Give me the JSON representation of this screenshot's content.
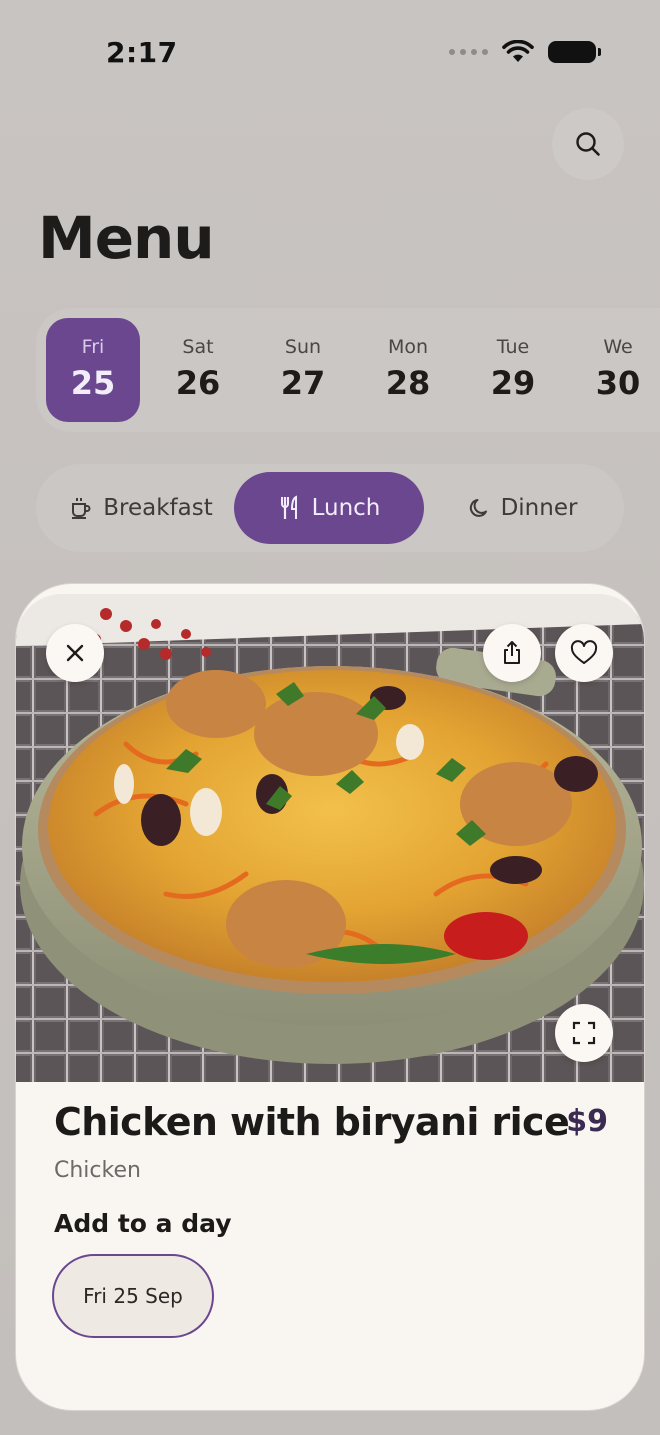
{
  "status_bar": {
    "time": "2:17"
  },
  "header": {
    "title": "Menu",
    "search_icon": "search-icon"
  },
  "date_strip": {
    "days": [
      {
        "name": "Fri",
        "number": "25",
        "selected": true
      },
      {
        "name": "Sat",
        "number": "26",
        "selected": false
      },
      {
        "name": "Sun",
        "number": "27",
        "selected": false
      },
      {
        "name": "Mon",
        "number": "28",
        "selected": false
      },
      {
        "name": "Tue",
        "number": "29",
        "selected": false
      },
      {
        "name": "We",
        "number": "30",
        "selected": false
      }
    ]
  },
  "meal_tabs": [
    {
      "label": "Breakfast",
      "icon": "coffee-cup-icon",
      "selected": false
    },
    {
      "label": "Lunch",
      "icon": "fork-knife-icon",
      "selected": true
    },
    {
      "label": "Dinner",
      "icon": "moon-icon",
      "selected": false
    }
  ],
  "dish": {
    "name": "Chicken with biryani rice",
    "price": "$9",
    "category": "Chicken",
    "add_to_day_label": "Add to a day",
    "selected_day_chip": "Fri 25 Sep"
  },
  "colors": {
    "accent": "#6a478f",
    "background": "#c8c4c2",
    "card": "#f9f6f2",
    "price": "#3b2a52"
  }
}
